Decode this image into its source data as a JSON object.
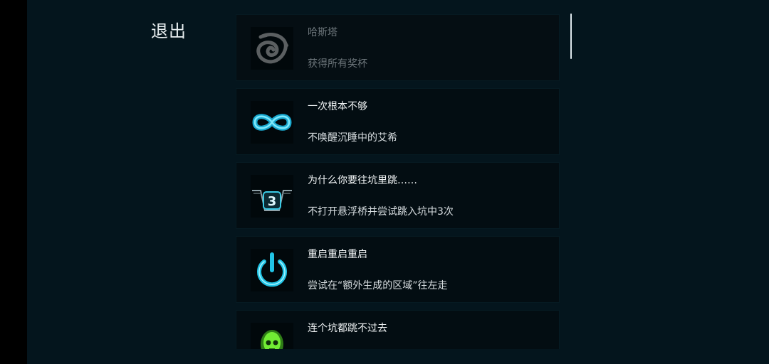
{
  "exit_label": "退出",
  "achievements": [
    {
      "title": "哈斯塔",
      "desc": "获得所有奖杯",
      "icon": "swirl-icon",
      "locked": true
    },
    {
      "title": "一次根本不够",
      "desc": "不唤醒沉睡中的艾希",
      "icon": "infinity-icon",
      "locked": false
    },
    {
      "title": "为什么你要往坑里跳……",
      "desc": "不打开悬浮桥并尝试跳入坑中3次",
      "icon": "pit-three-icon",
      "icon_number": "3",
      "locked": false
    },
    {
      "title": "重启重启重启",
      "desc": "尝试在“额外生成的区域”往左走",
      "icon": "power-icon",
      "locked": false
    },
    {
      "title": "连个坑都跳不过去",
      "desc": "",
      "icon": "skull-icon",
      "locked": false
    }
  ],
  "colors": {
    "background": "#04151d",
    "card": "#030d12",
    "accent_cyan": "#38d6f0",
    "accent_green": "#7cff3a"
  }
}
